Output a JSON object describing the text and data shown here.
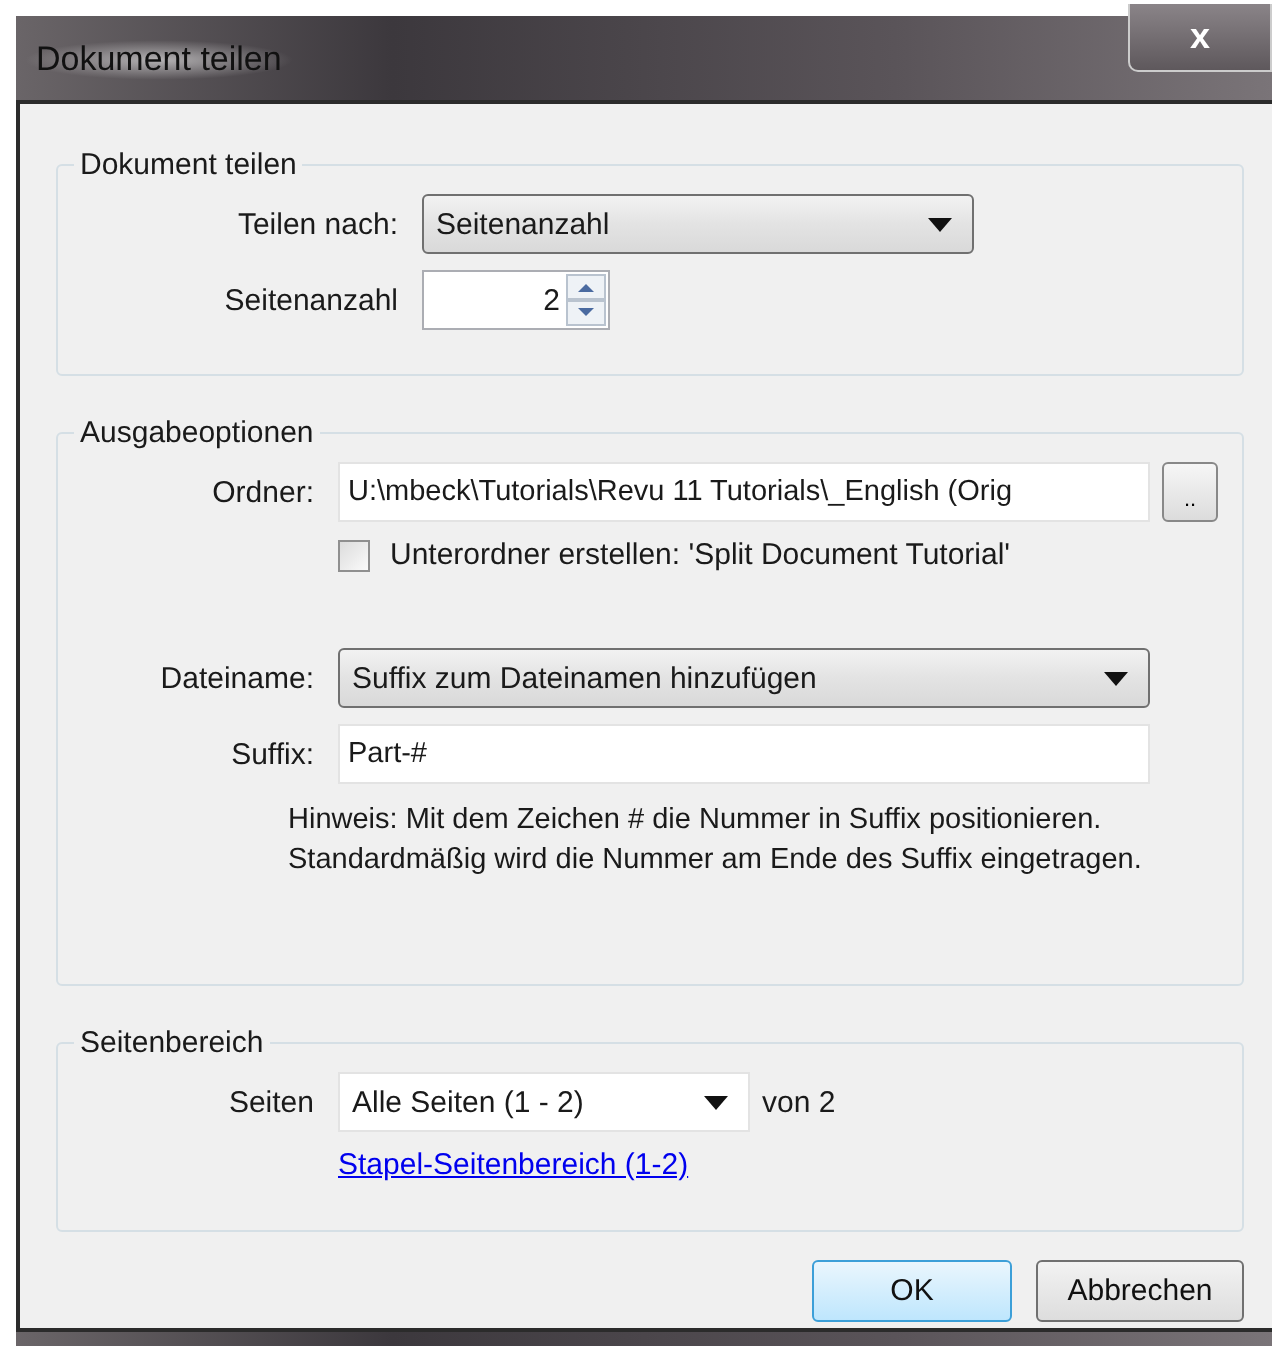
{
  "window": {
    "title": "Dokument teilen",
    "close": "x"
  },
  "split_group": {
    "title": "Dokument teilen",
    "split_by_label": "Teilen nach:",
    "split_by_value": "Seitenanzahl",
    "page_count_label": "Seitenanzahl",
    "page_count_value": "2"
  },
  "output_group": {
    "title": "Ausgabeoptionen",
    "folder_label": "Ordner:",
    "folder_value": "U:\\mbeck\\Tutorials\\Revu 11 Tutorials\\_English (Orig",
    "browse_button": "..",
    "subfolder": {
      "label": "Unterordner erstellen: 'Split Document Tutorial'",
      "checked": false
    },
    "filename_label": "Dateiname:",
    "filename_value": "Suffix zum Dateinamen hinzufügen",
    "suffix_label": "Suffix:",
    "suffix_value": "Part-#",
    "hint": "Hinweis: Mit dem Zeichen # die Nummer in Suffix positionieren.\nStandardmäßig wird die Nummer am Ende des Suffix eingetragen."
  },
  "range_group": {
    "title": "Seitenbereich",
    "pages_label": "Seiten",
    "pages_value": "Alle Seiten (1 - 2)",
    "of_text": "von 2",
    "batch_link": "Stapel-Seitenbereich (1-2)"
  },
  "buttons": [
    {
      "label": "OK",
      "default": true
    },
    {
      "label": "Abbrechen",
      "default": false
    }
  ]
}
